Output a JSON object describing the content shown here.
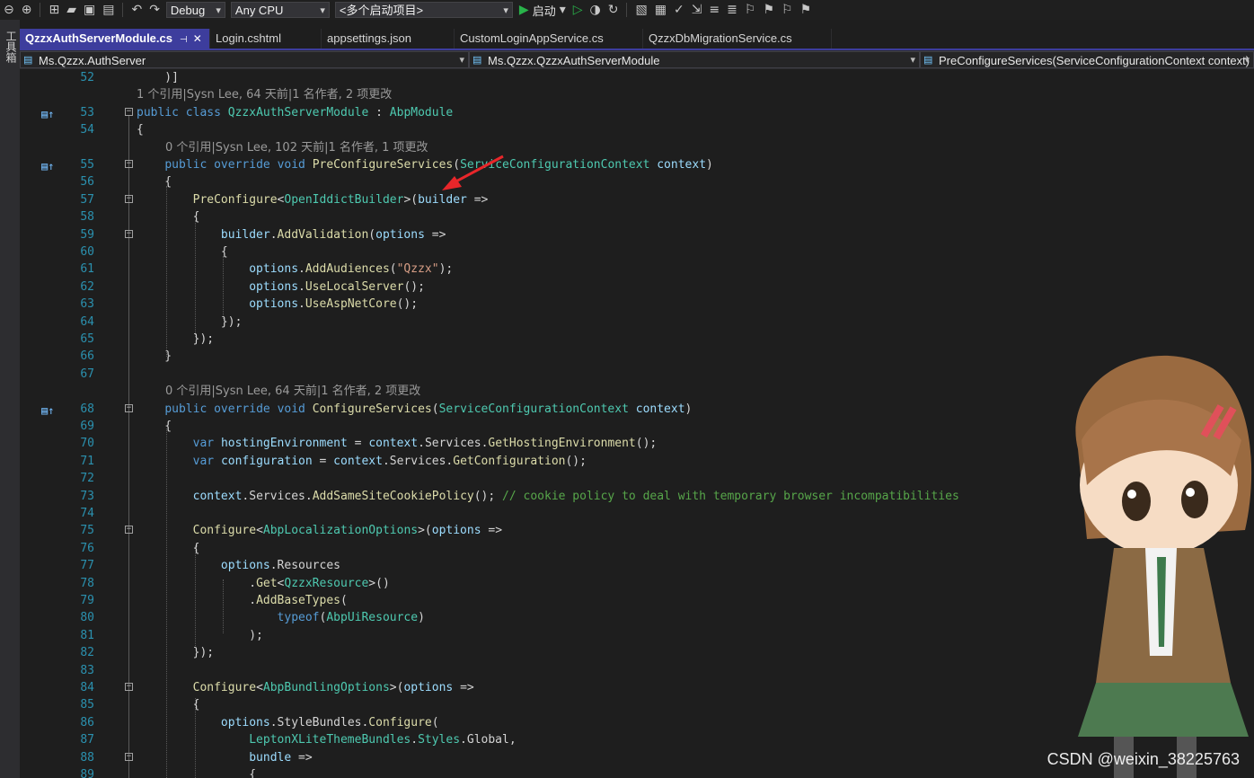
{
  "toolbar": {
    "config": "Debug",
    "platform": "Any CPU",
    "startup": "<多个启动项目>",
    "start_label": "启动"
  },
  "left_rail": {
    "label": "工具箱"
  },
  "tabs": [
    {
      "label": "QzzxAuthServerModule.cs",
      "active": true
    },
    {
      "label": "Login.cshtml"
    },
    {
      "label": "appsettings.json"
    },
    {
      "label": "CustomLoginAppService.cs"
    },
    {
      "label": "QzzxDbMigrationService.cs"
    }
  ],
  "navbar": {
    "project": "Ms.Qzzx.AuthServer",
    "type": "Ms.Qzzx.QzzxAuthServerModule",
    "member": "PreConfigureServices(ServiceConfigurationContext context)"
  },
  "codelens": {
    "class": "1 个引用|Sysn Lee, 64 天前|1 名作者, 2 项更改",
    "preconfigure": "0 个引用|Sysn Lee, 102 天前|1 名作者, 1 项更改",
    "configure": "0 个引用|Sysn Lee, 64 天前|1 名作者, 2 项更改"
  },
  "watermark": "CSDN @weixin_38225763",
  "lines": [
    {
      "n": "52",
      "t": "    )]"
    },
    {
      "n": "53",
      "t": "public class QzzxAuthServerModule : AbpModule"
    },
    {
      "n": "54",
      "t": "{"
    },
    {
      "n": "55",
      "t": "    public override void PreConfigureServices(ServiceConfigurationContext context)"
    },
    {
      "n": "56",
      "t": "    {"
    },
    {
      "n": "57",
      "t": "        PreConfigure<OpenIddictBuilder>(builder =>"
    },
    {
      "n": "58",
      "t": "        {"
    },
    {
      "n": "59",
      "t": "            builder.AddValidation(options =>"
    },
    {
      "n": "60",
      "t": "            {"
    },
    {
      "n": "61",
      "t": "                options.AddAudiences(\"Qzzx\");"
    },
    {
      "n": "62",
      "t": "                options.UseLocalServer();"
    },
    {
      "n": "63",
      "t": "                options.UseAspNetCore();"
    },
    {
      "n": "64",
      "t": "            });"
    },
    {
      "n": "65",
      "t": "        });"
    },
    {
      "n": "66",
      "t": "    }"
    },
    {
      "n": "67",
      "t": ""
    },
    {
      "n": "68",
      "t": "    public override void ConfigureServices(ServiceConfigurationContext context)"
    },
    {
      "n": "69",
      "t": "    {"
    },
    {
      "n": "70",
      "t": "        var hostingEnvironment = context.Services.GetHostingEnvironment();"
    },
    {
      "n": "71",
      "t": "        var configuration = context.Services.GetConfiguration();"
    },
    {
      "n": "72",
      "t": ""
    },
    {
      "n": "73",
      "t": "        context.Services.AddSameSiteCookiePolicy(); // cookie policy to deal with temporary browser incompatibilities"
    },
    {
      "n": "74",
      "t": ""
    },
    {
      "n": "75",
      "t": "        Configure<AbpLocalizationOptions>(options =>"
    },
    {
      "n": "76",
      "t": "        {"
    },
    {
      "n": "77",
      "t": "            options.Resources"
    },
    {
      "n": "78",
      "t": "                .Get<QzzxResource>()"
    },
    {
      "n": "79",
      "t": "                .AddBaseTypes("
    },
    {
      "n": "80",
      "t": "                    typeof(AbpUiResource)"
    },
    {
      "n": "81",
      "t": "                );"
    },
    {
      "n": "82",
      "t": "        });"
    },
    {
      "n": "83",
      "t": ""
    },
    {
      "n": "84",
      "t": "        Configure<AbpBundlingOptions>(options =>"
    },
    {
      "n": "85",
      "t": "        {"
    },
    {
      "n": "86",
      "t": "            options.StyleBundles.Configure("
    },
    {
      "n": "87",
      "t": "                LeptonXLiteThemeBundles.Styles.Global,"
    },
    {
      "n": "88",
      "t": "                bundle =>"
    },
    {
      "n": "89",
      "t": "                {"
    }
  ]
}
